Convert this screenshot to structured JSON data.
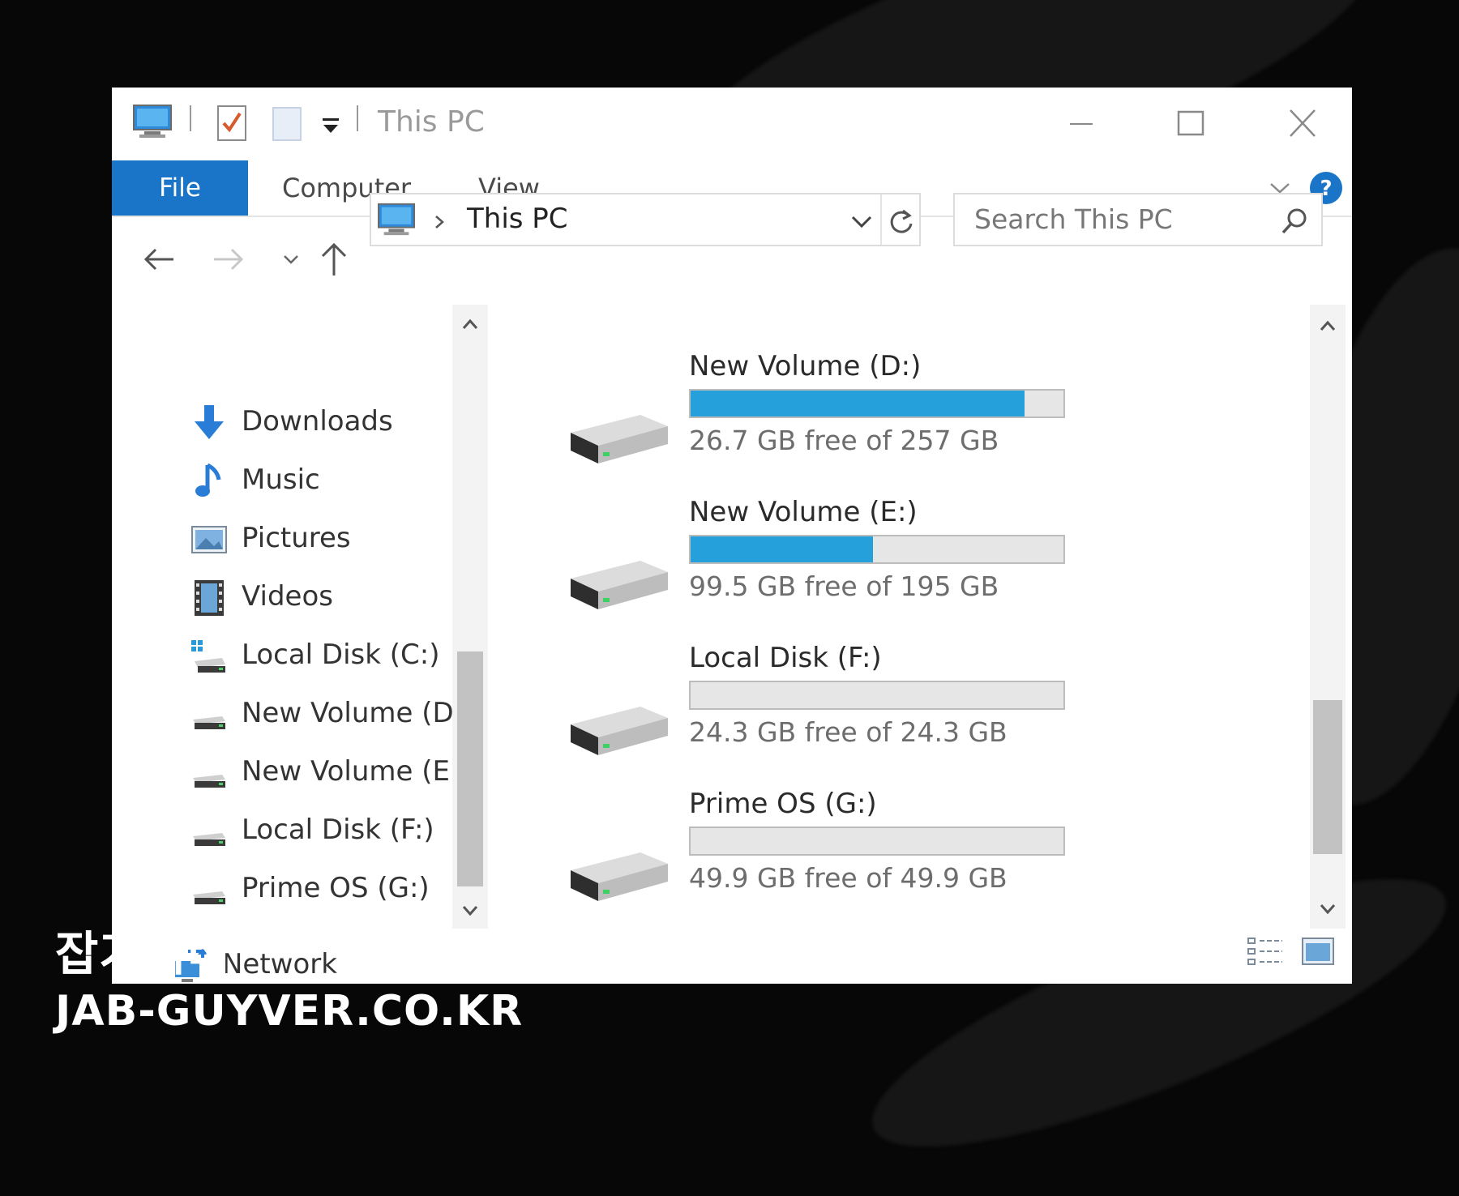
{
  "window": {
    "title": "This PC"
  },
  "ribbon": {
    "tabs": [
      {
        "label": "File",
        "active": true
      },
      {
        "label": "Computer"
      },
      {
        "label": "View"
      }
    ]
  },
  "address": {
    "location": "This PC"
  },
  "search": {
    "placeholder": "Search This PC"
  },
  "nav_pane": {
    "items": [
      {
        "label": "Downloads",
        "icon": "download-icon"
      },
      {
        "label": "Music",
        "icon": "music-icon"
      },
      {
        "label": "Pictures",
        "icon": "pictures-icon"
      },
      {
        "label": "Videos",
        "icon": "videos-icon"
      },
      {
        "label": "Local Disk (C:)",
        "icon": "system-drive-icon"
      },
      {
        "label": "New Volume (D:)",
        "icon": "drive-icon"
      },
      {
        "label": "New Volume (E:)",
        "icon": "drive-icon"
      },
      {
        "label": "Local Disk (F:)",
        "icon": "drive-icon"
      },
      {
        "label": "Prime OS (G:)",
        "icon": "drive-icon"
      }
    ],
    "network": {
      "label": "Network",
      "icon": "network-icon"
    }
  },
  "drives": [
    {
      "name": "New Volume (D:)",
      "free_text": "26.7 GB free of 257 GB",
      "used_fraction": 0.896
    },
    {
      "name": "New Volume (E:)",
      "free_text": "99.5 GB free of 195 GB",
      "used_fraction": 0.49
    },
    {
      "name": "Local Disk (F:)",
      "free_text": "24.3 GB free of 24.3 GB",
      "used_fraction": 0.0
    },
    {
      "name": "Prime OS (G:)",
      "free_text": "49.9 GB free of 49.9 GB",
      "used_fraction": 0.0
    }
  ],
  "watermark": {
    "korean": "잡가이버",
    "site": "JAB-GUYVER.CO.KR"
  },
  "colors": {
    "accent": "#1a74c8",
    "progress": "#26a0da",
    "help": "#1a74c8"
  }
}
